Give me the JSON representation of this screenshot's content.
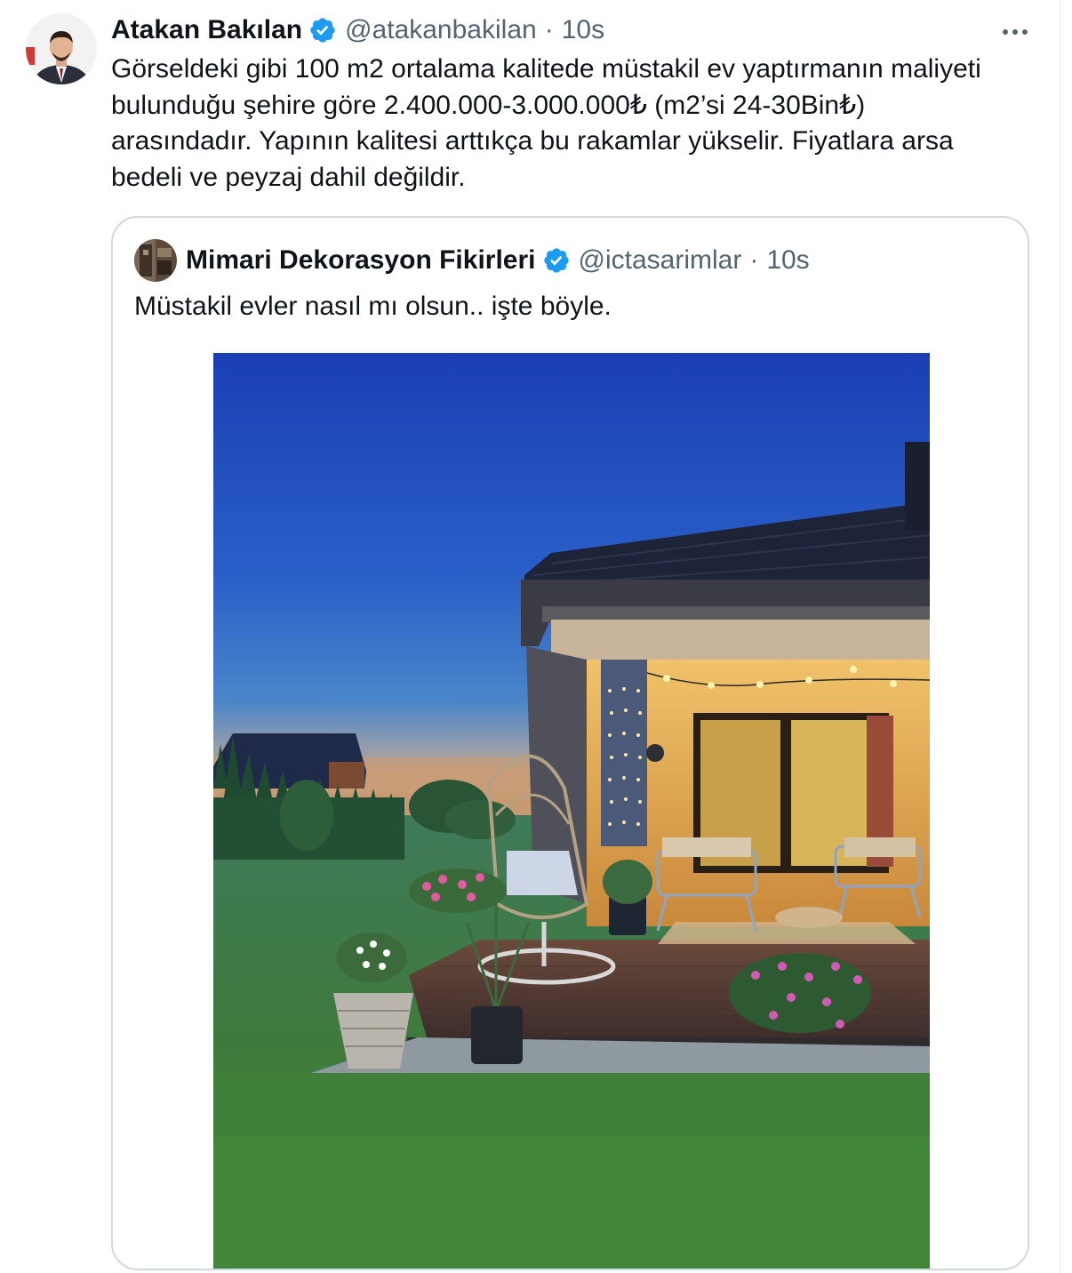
{
  "tweet": {
    "display_name": "Atakan Bakılan",
    "handle": "@atakanbakilan",
    "separator": "·",
    "time": "10s",
    "text": "Görseldeki gibi 100 m2 ortalama kalitede müstakil ev yaptırmanın maliyeti\nbulunduğu şehire göre 2.400.000-3.000.000₺ (m2’si 24-30Bin₺)\narasındadır. Yapının kalitesi arttıkça bu rakamlar yükselir. Fiyatlara arsa\nbedeli ve peyzaj dahil değildir.",
    "avatar_icon": "avatar-photo",
    "more_icon": "more-horizontal-icon",
    "verified_icon": "verified-badge-icon"
  },
  "quoted_tweet": {
    "display_name": "Mimari Dekorasyon Fikirleri",
    "handle": "@ictasarimlar",
    "separator": "·",
    "time": "10s",
    "text": "Müstakil evler nasıl mı olsun.. işte böyle.",
    "media_icon": "house-patio-photo",
    "verified_icon": "verified-badge-icon"
  },
  "colors": {
    "text_primary": "#0f1419",
    "text_secondary": "#536471",
    "verified_blue": "#1d9bf0",
    "border": "#cfd9de"
  }
}
